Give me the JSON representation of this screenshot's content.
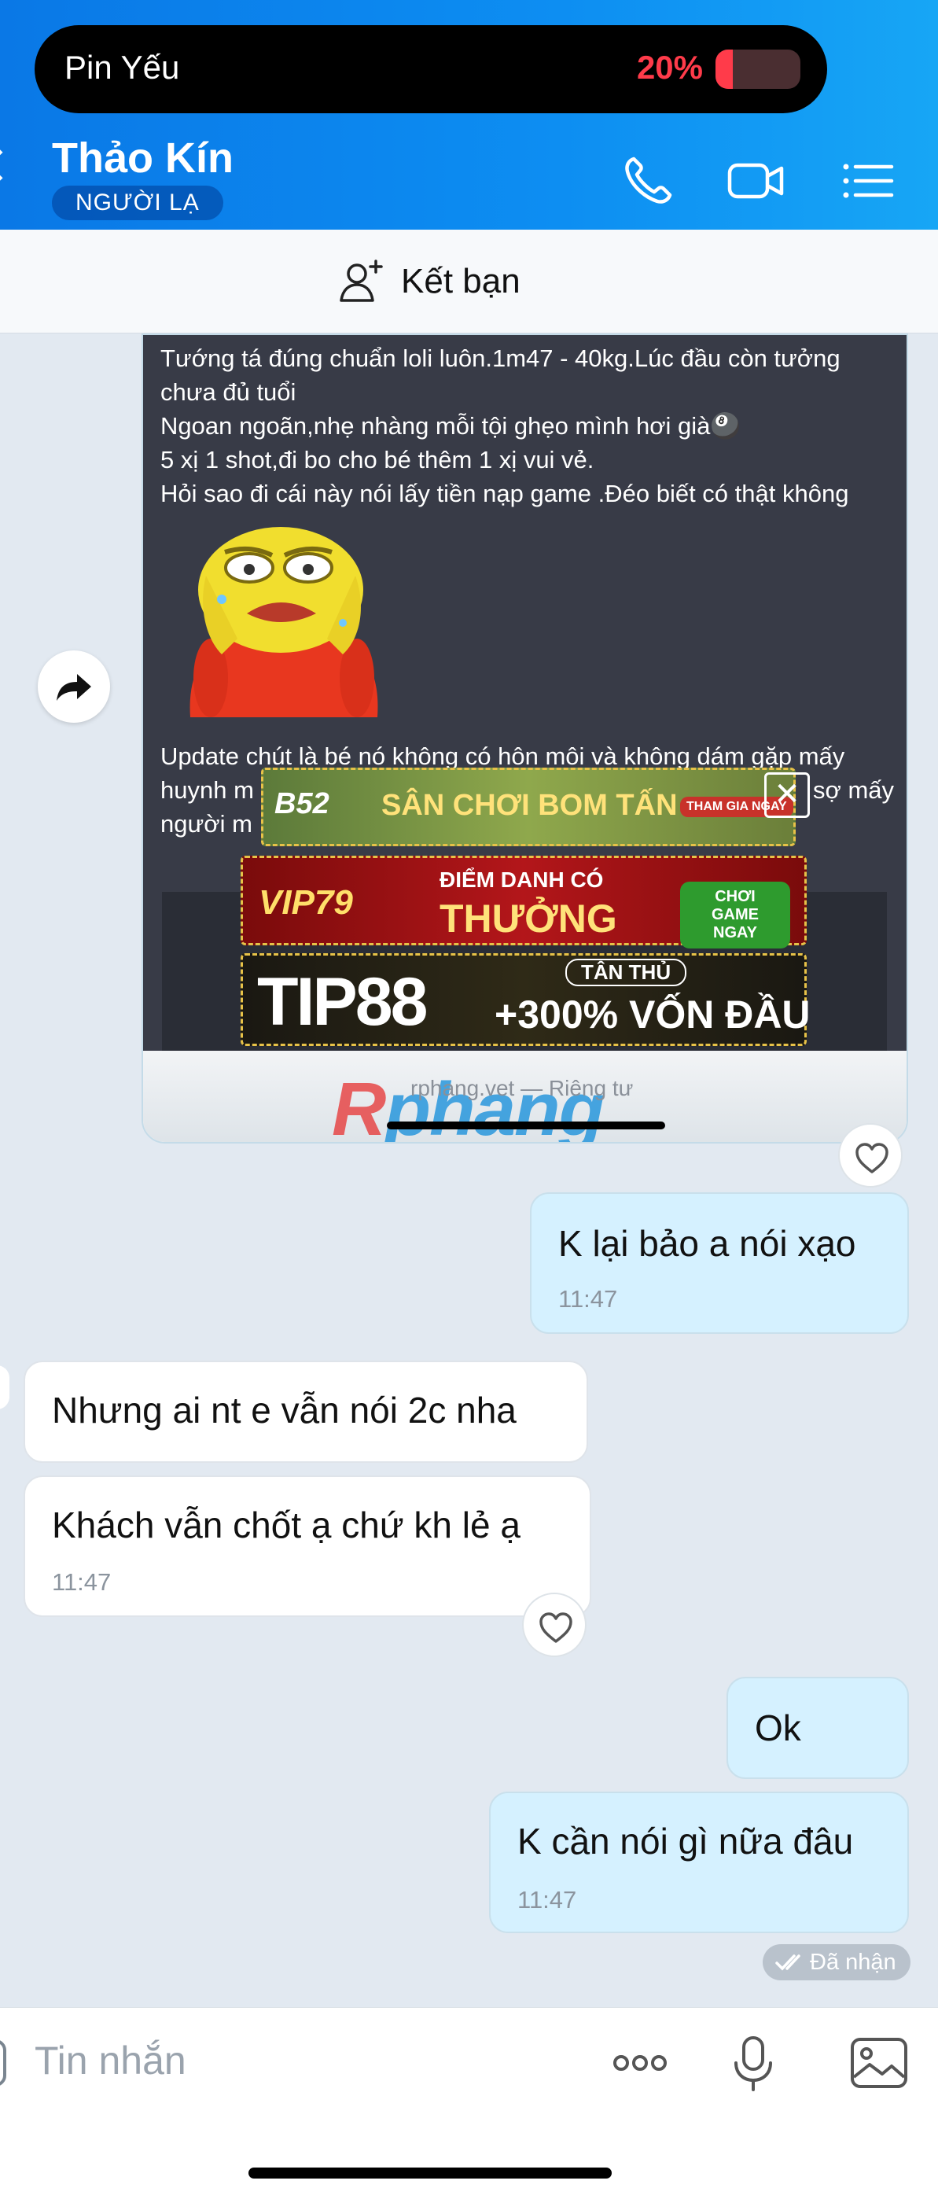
{
  "status": {
    "battery_label": "Pin Yếu",
    "battery_percent": "20%",
    "battery_level": 0.2,
    "battery_color": "#ff3b4a"
  },
  "header": {
    "contact_name": "Thảo Kín",
    "badge": "NGƯỜI LẠ",
    "icons": [
      "back-chevron-icon",
      "phone-icon",
      "video-call-icon",
      "menu-list-icon"
    ]
  },
  "friend_bar": {
    "label": "Kết bạn",
    "icon": "add-user-icon"
  },
  "shared_post": {
    "lines": [
      "Tướng tá đúng chuẩn loli luôn.1m47 - 40kg.Lúc đầu còn tưởng",
      "chưa đủ tuổi",
      "Ngoan ngoãn,nhẹ nhàng mỗi tội ghẹo mình hơi già🎱",
      "5 xị 1 shot,đi bo cho bé thêm 1 xị vui vẻ.",
      "Hỏi sao đi cái này nói lấy tiền nạp game .Đéo biết có thật không"
    ],
    "update_lines": [
      "Update chút là bé nó không có hôn môi và không dám gặp mấy",
      "huynh m",
      "sợ mấy",
      "người m"
    ],
    "ads": [
      {
        "main": "SÂN CHƠI BOM TẤN",
        "brand": "B52",
        "cta": "THAM GIA NGAY"
      },
      {
        "main": "THƯỞNG",
        "top": "ĐIỂM DANH CÓ",
        "brand": "VIP79",
        "cta": "CHƠI GAME NGAY"
      },
      {
        "main": "+300% VỐN ĐẦU",
        "top": "TÂN THỦ",
        "brand": "TIP88"
      }
    ],
    "domain": "rphang.vet — Riêng tư",
    "watermark": "Rphang"
  },
  "messages": [
    {
      "dir": "out",
      "text": "K lại bảo a nói xạo",
      "time": "11:47"
    },
    {
      "dir": "in",
      "text": "Nhưng ai nt e vẫn nói 2c nha"
    },
    {
      "dir": "in",
      "text": "Khách vẫn chốt ạ chứ kh lẻ ạ",
      "time": "11:47"
    },
    {
      "dir": "out",
      "text": "Ok"
    },
    {
      "dir": "out",
      "text": "K cần nói gì nữa đâu",
      "time": "11:47"
    }
  ],
  "seen_status": "Đã nhận",
  "input": {
    "placeholder": "Tin nhắn",
    "icons": [
      "more-dots-icon",
      "microphone-icon",
      "image-icon"
    ]
  }
}
